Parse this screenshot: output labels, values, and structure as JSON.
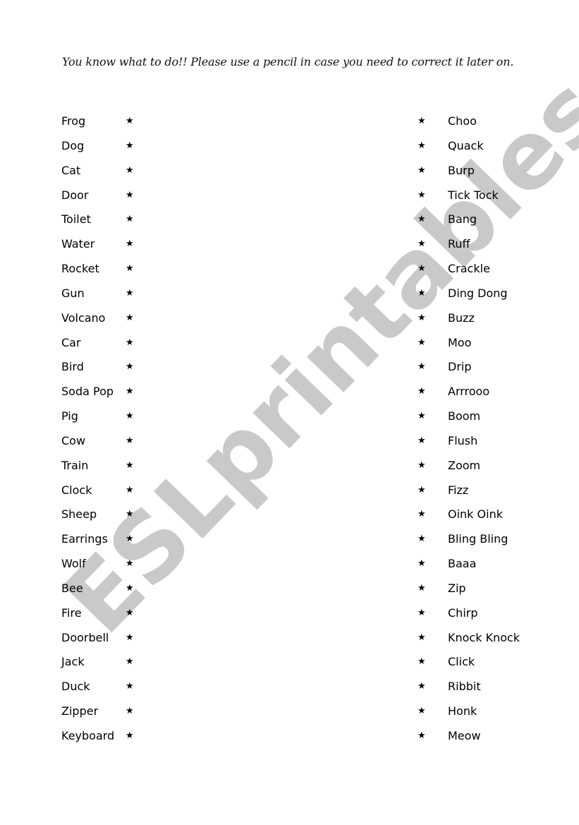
{
  "instructions": "You know what to do!!  Please use a pencil in case you need to correct it later on.",
  "watermark": "ESLprintables.com",
  "bullet_icon": "★",
  "left_column": [
    "Frog",
    "Dog",
    "Cat",
    "Door",
    "Toilet",
    "Water",
    "Rocket",
    "Gun",
    "Volcano",
    "Car",
    "Bird",
    "Soda Pop",
    "Pig",
    "Cow",
    "Train",
    "Clock",
    "Sheep",
    "Earrings",
    "Wolf",
    "Bee",
    "Fire",
    "Doorbell",
    "Jack",
    "Duck",
    "Zipper",
    "Keyboard"
  ],
  "right_column": [
    "Choo",
    "Quack",
    "Burp",
    "Tick Tock",
    "Bang",
    "Ruff",
    "Crackle",
    "Ding Dong",
    "Buzz",
    "Moo",
    "Drip",
    "Arrrooo",
    "Boom",
    "Flush",
    "Zoom",
    "Fizz",
    "Oink Oink",
    "Bling Bling",
    "Baaa",
    "Zip",
    "Chirp",
    "Knock Knock",
    "Click",
    "Ribbit",
    "Honk",
    "Meow"
  ]
}
